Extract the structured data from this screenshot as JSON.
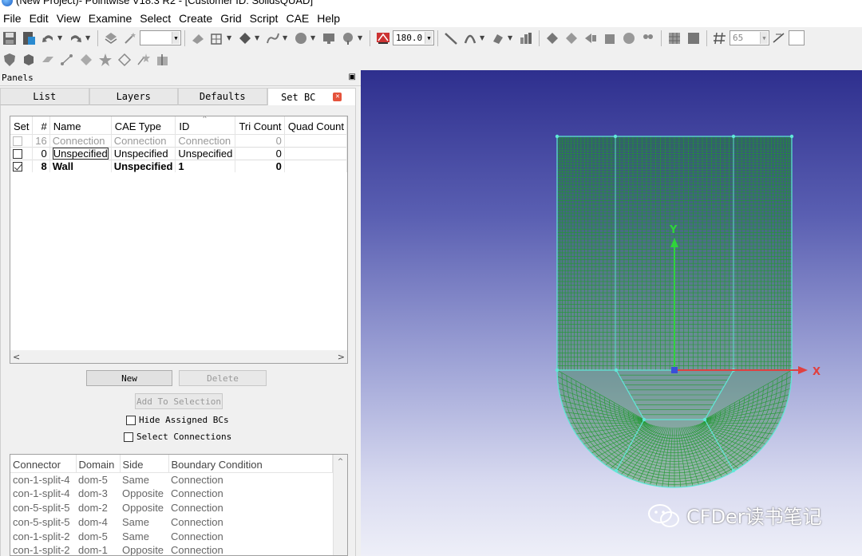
{
  "window": {
    "title": "(New Project)- Pointwise V18.3 R2 - [Customer ID: SolidsQUAD]"
  },
  "menu": [
    "File",
    "Edit",
    "View",
    "Examine",
    "Select",
    "Create",
    "Grid",
    "Script",
    "CAE",
    "Help"
  ],
  "toolbar": {
    "angle_value": "180.0",
    "count_value": "65"
  },
  "panels": {
    "header": "Panels",
    "tabs": [
      "List",
      "Layers",
      "Defaults",
      "Set BC"
    ],
    "active_tab": "Set BC"
  },
  "bc_table": {
    "columns": [
      "Set",
      "#",
      "Name",
      "CAE Type",
      "ID",
      "Tri Count",
      "Quad Count"
    ],
    "rows": [
      {
        "set": "unchecked-dim",
        "num": "16",
        "name": "Connection",
        "cae_type": "Connection",
        "id": "Connection",
        "tri": "0",
        "quad": ""
      },
      {
        "set": "unchecked",
        "num": "0",
        "name": "Unspecified",
        "cae_type": "Unspecified",
        "id": "Unspecified",
        "tri": "0",
        "quad": ""
      },
      {
        "set": "checked",
        "num": "8",
        "name": "Wall",
        "cae_type": "Unspecified",
        "id": "1",
        "tri": "0",
        "quad": ""
      }
    ]
  },
  "buttons": {
    "new": "New",
    "delete": "Delete",
    "add_to_selection": "Add To Selection"
  },
  "options": {
    "hide_assigned": "Hide Assigned BCs",
    "select_connections": "Select Connections"
  },
  "conn_table": {
    "columns": [
      "Connector",
      "Domain",
      "Side",
      "Boundary Condition"
    ],
    "rows": [
      [
        "con-1-split-4",
        "dom-5",
        "Same",
        "Connection"
      ],
      [
        "con-1-split-4",
        "dom-3",
        "Opposite",
        "Connection"
      ],
      [
        "con-5-split-5",
        "dom-2",
        "Opposite",
        "Connection"
      ],
      [
        "con-5-split-5",
        "dom-4",
        "Same",
        "Connection"
      ],
      [
        "con-1-split-2",
        "dom-5",
        "Same",
        "Connection"
      ],
      [
        "con-1-split-2",
        "dom-1",
        "Opposite",
        "Connection"
      ]
    ]
  },
  "viewport": {
    "axis_y": "Y",
    "axis_x": "X"
  },
  "watermark": "CFDer读书笔记",
  "colors": {
    "mesh": "#1f9a2f",
    "axis_y": "#2fd43a",
    "axis_x": "#e04040",
    "edge": "#60e8d8"
  }
}
